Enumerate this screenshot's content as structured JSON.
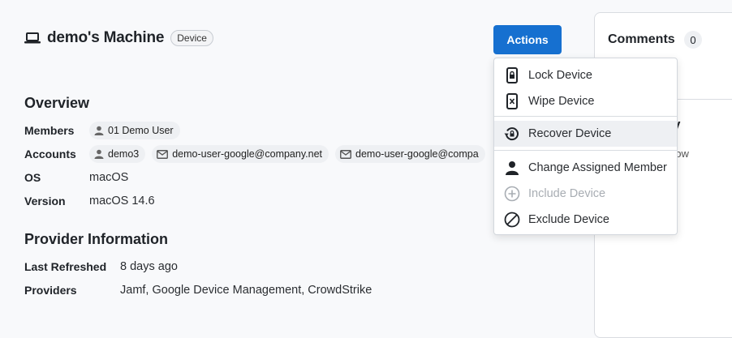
{
  "header": {
    "title": "demo's Machine",
    "badge": "Device",
    "icon": "laptop-icon"
  },
  "actions": {
    "label": "Actions",
    "color": "#1670d0"
  },
  "overview": {
    "title": "Overview",
    "members_label": "Members",
    "members": [
      "01 Demo User"
    ],
    "accounts_label": "Accounts",
    "accounts": [
      {
        "icon": "user-icon",
        "text": "demo3"
      },
      {
        "icon": "mail-icon",
        "text": "demo-user-google@company.net"
      },
      {
        "icon": "mail-icon",
        "text": "demo-user-google@compa"
      }
    ],
    "os_label": "OS",
    "os_value": "macOS",
    "version_label": "Version",
    "version_value": "macOS 14.6"
  },
  "provider": {
    "title": "Provider Information",
    "last_refreshed_label": "Last Refreshed",
    "last_refreshed_value": "8 days ago",
    "providers_label": "Providers",
    "providers_value": "Jamf, Google Device Management, CrowdStrike"
  },
  "comments": {
    "title": "Comments",
    "count": "0",
    "fragment_1": "y",
    "fragment_2": "how"
  },
  "menu": {
    "items": [
      {
        "label": "Lock Device",
        "icon": "lock-device-icon",
        "state": "normal"
      },
      {
        "label": "Wipe Device",
        "icon": "wipe-device-icon",
        "state": "normal"
      },
      {
        "label": "Recover Device",
        "icon": "recover-device-icon",
        "state": "highlighted"
      },
      {
        "label": "Change Assigned Member",
        "icon": "person-icon",
        "state": "normal"
      },
      {
        "label": "Include Device",
        "icon": "plus-circle-icon",
        "state": "disabled"
      },
      {
        "label": "Exclude Device",
        "icon": "block-icon",
        "state": "normal"
      }
    ]
  }
}
